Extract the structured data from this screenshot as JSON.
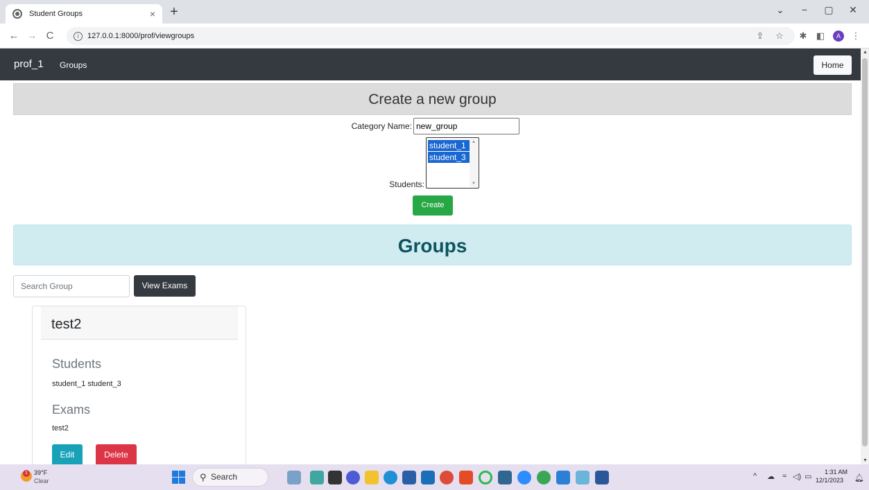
{
  "browser": {
    "tab_title": "Student Groups",
    "tab_close": "×",
    "new_tab": "+",
    "url": "127.0.0.1:8000/prof/viewgroups",
    "back": "←",
    "forward": "→",
    "reload": "C",
    "profile_initial": "A",
    "window_minimize": "−",
    "window_restore": "▢",
    "window_close": "✕",
    "tab_search": "⌄"
  },
  "navbar": {
    "brand": "prof_1",
    "link_groups": "Groups",
    "home_button": "Home"
  },
  "create_group": {
    "heading": "Create a new group",
    "category_label": "Category Name:",
    "category_value": "new_group",
    "students_label": "Students:",
    "students_options": [
      "student_1",
      "student_3"
    ],
    "create_button": "Create"
  },
  "groups": {
    "heading": "Groups",
    "search_placeholder": "Search Group",
    "view_exams_button": "View Exams",
    "cards": [
      {
        "title": "test2",
        "students_heading": "Students",
        "students_text": "student_1 student_3",
        "exams_heading": "Exams",
        "exams_text": "test2",
        "edit_button": "Edit",
        "delete_button": "Delete"
      }
    ]
  },
  "taskbar": {
    "weather_temp": "39°F",
    "weather_condition": "Clear",
    "weather_badge": "1",
    "search_label": "Search",
    "time": "1:31 AM",
    "date": "12/1/2023"
  },
  "colors": {
    "navbar_bg": "#343a40",
    "success": "#28a745",
    "info": "#17a2b8",
    "danger": "#dc3545",
    "alert_info_bg": "#d1ecf1",
    "alert_info_text": "#0c5460",
    "selected_option": "#1967d2"
  }
}
